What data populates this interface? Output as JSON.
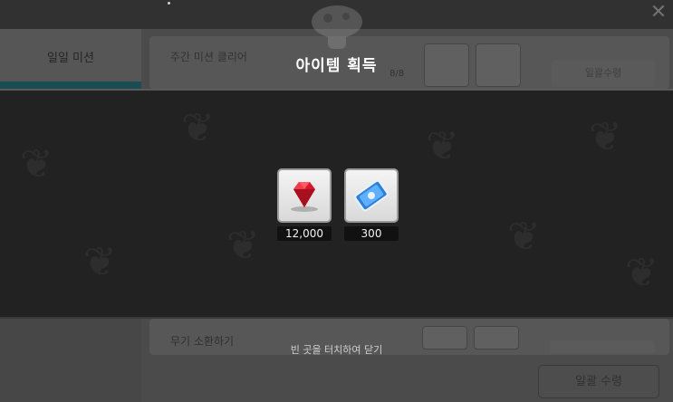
{
  "window": {
    "close_icon": "close-icon"
  },
  "sidebar": {
    "tab_daily_label": "일일 미션"
  },
  "missions": {
    "weekly": {
      "title": "주간 미션 클리어",
      "count": "8/8",
      "claim_label": "일괄수령"
    },
    "summon": {
      "title": "무기 소환하기"
    },
    "claim_all_label": "일괄 수령"
  },
  "popup": {
    "title": "아이템 획득",
    "items": [
      {
        "icon": "ruby-gem-icon",
        "quantity": "12,000"
      },
      {
        "icon": "blue-ticket-icon",
        "quantity": "300"
      }
    ],
    "close_hint": "빈 곳을 터치하여 닫기"
  },
  "colors": {
    "popup_bg": "#222222",
    "title": "#ffffff",
    "ruby": "#d8182b",
    "ticket": "#2e7fd6"
  }
}
